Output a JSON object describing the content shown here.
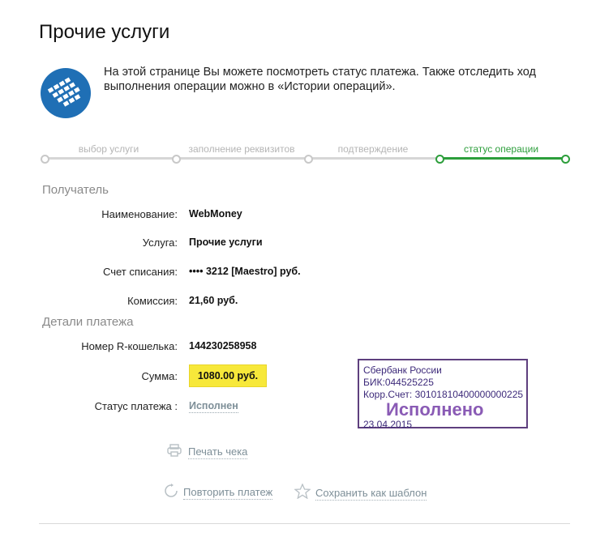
{
  "page": {
    "title": "Прочие услуги",
    "intro": "На этой странице Вы можете посмотреть статус платежа. Также отследить ход выполнения операции можно в «Истории операций»."
  },
  "steps": [
    {
      "label": "выбор услуги"
    },
    {
      "label": "заполнение реквизитов"
    },
    {
      "label": "подтверждение"
    },
    {
      "label": "статус операции"
    }
  ],
  "recipient": {
    "section_title": "Получатель",
    "name_label": "Наименование:",
    "name_value": "WebMoney",
    "service_label": "Услуга:",
    "service_value": "Прочие услуги",
    "account_label": "Счет списания:",
    "account_value": "•••• 3212  [Maestro]  руб.",
    "fee_label": "Комиссия:",
    "fee_value": "21,60 руб."
  },
  "details": {
    "section_title": "Детали платежа",
    "wallet_label": "Номер R-кошелька:",
    "wallet_value": "144230258958",
    "amount_label": "Сумма:",
    "amount_value": "1080.00 руб.",
    "status_label": "Статус платежа :",
    "status_value": "Исполнен"
  },
  "stamp": {
    "bank": "Сбербанк России",
    "bik": "БИК:044525225",
    "corr": "Корр.Счет: 30101810400000000225",
    "status": "Исполнено",
    "date": "23.04.2015"
  },
  "actions": {
    "print_label": "Печать чека",
    "repeat_label": "Повторить платеж",
    "save_template_label": "Сохранить как шаблон"
  },
  "colors": {
    "accent": "#2c9e3b",
    "step_inactive": "#cfcfcf",
    "highlight": "#f7e83a",
    "stamp": "#5e3f7e",
    "link": "#7e8f98"
  },
  "icons": {
    "logo": "webmoney-logo",
    "print": "printer-icon",
    "repeat": "repeat-icon",
    "template": "star-icon"
  }
}
